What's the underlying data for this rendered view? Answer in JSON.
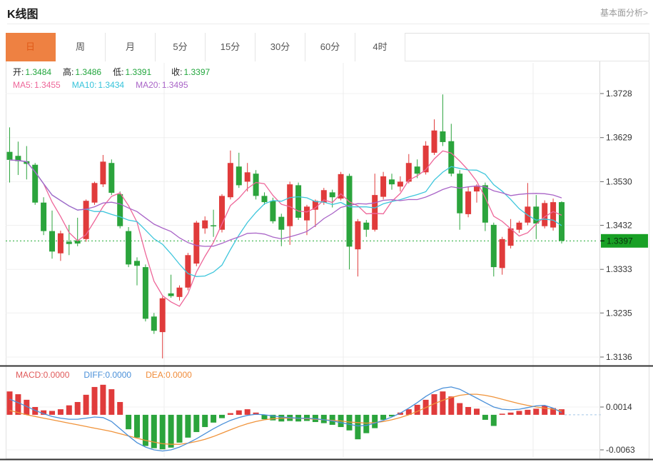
{
  "app": {
    "title": "K线图",
    "fundamental_link": "基本面分析>"
  },
  "tabs": {
    "items": [
      "日",
      "周",
      "月",
      "5分",
      "15分",
      "30分",
      "60分",
      "4时"
    ],
    "selected_index": 0
  },
  "quote": {
    "open_label": "开:",
    "open": "1.3484",
    "high_label": "高:",
    "high": "1.3486",
    "low_label": "低:",
    "low": "1.3391",
    "close_label": "收:",
    "close": "1.3397"
  },
  "ma_legend": {
    "ma5_label": "MA5:",
    "ma5": "1.3455",
    "ma10_label": "MA10:",
    "ma10": "1.3434",
    "ma20_label": "MA20:",
    "ma20": "1.3495"
  },
  "macd_legend": {
    "macd_label": "MACD:",
    "macd": "0.0000",
    "diff_label": "DIFF:",
    "diff": "0.0000",
    "dea_label": "DEA:",
    "dea": "0.0000"
  },
  "colors": {
    "up": "#e03b3b",
    "down": "#2ba43c",
    "ma5": "#ee6699",
    "ma10": "#3ec6dc",
    "ma20": "#a964c7",
    "diff_line": "#4a90d9",
    "dea_line": "#f0933a",
    "badge_bg": "#18a025",
    "badge_text": "#072c0a",
    "accent_tab": "#ee8142",
    "grid": "#f0f0f0",
    "axis": "#d8d8d8",
    "tick": "#666666",
    "dark_divider": "#333333",
    "label": "#333333",
    "last_price_line": "#22aa33",
    "zero_dash": "#a5c6e8"
  },
  "chart_data": {
    "type": "candlestick-with-macd",
    "title": "K线图",
    "legend_position": "top-left",
    "grid": true,
    "main": {
      "y_axis_labels": [
        "1.3728",
        "1.3629",
        "1.3530",
        "1.3432",
        "1.3333",
        "1.3235",
        "1.3136"
      ],
      "y_axis_values": [
        1.3728,
        1.3629,
        1.353,
        1.3432,
        1.3333,
        1.3235,
        1.3136
      ],
      "ylim": [
        1.3136,
        1.3728
      ],
      "last_price_label": "1.3397",
      "last_price": 1.3397,
      "ma_periods": [
        5,
        10,
        20
      ],
      "candles_ohlc": [
        [
          1.3597,
          1.3652,
          1.3528,
          1.3579
        ],
        [
          1.3588,
          1.362,
          1.3545,
          1.3576
        ],
        [
          1.3576,
          1.361,
          1.3535,
          1.357
        ],
        [
          1.3568,
          1.3572,
          1.3478,
          1.3483
        ],
        [
          1.3483,
          1.3495,
          1.341,
          1.3419
        ],
        [
          1.3419,
          1.3465,
          1.3357,
          1.3373
        ],
        [
          1.3369,
          1.342,
          1.3352,
          1.3414
        ],
        [
          1.3395,
          1.3433,
          1.3365,
          1.339
        ],
        [
          1.3398,
          1.3449,
          1.3385,
          1.3391
        ],
        [
          1.3401,
          1.349,
          1.3395,
          1.3487
        ],
        [
          1.3483,
          1.353,
          1.3478,
          1.3527
        ],
        [
          1.3524,
          1.359,
          1.3518,
          1.3575
        ],
        [
          1.3572,
          1.358,
          1.35,
          1.3505
        ],
        [
          1.3502,
          1.3508,
          1.3425,
          1.343
        ],
        [
          1.3419,
          1.3428,
          1.3338,
          1.3344
        ],
        [
          1.3352,
          1.336,
          1.3297,
          1.3341
        ],
        [
          1.3338,
          1.3344,
          1.3216,
          1.3222
        ],
        [
          1.3227,
          1.3235,
          1.3188,
          1.3195
        ],
        [
          1.3192,
          1.3272,
          1.3133,
          1.3268
        ],
        [
          1.3279,
          1.3321,
          1.3269,
          1.3273
        ],
        [
          1.3271,
          1.3297,
          1.3263,
          1.3292
        ],
        [
          1.3292,
          1.337,
          1.3286,
          1.3365
        ],
        [
          1.3346,
          1.3442,
          1.334,
          1.3438
        ],
        [
          1.3425,
          1.3452,
          1.3413,
          1.3443
        ],
        [
          1.3432,
          1.3467,
          1.3406,
          1.343
        ],
        [
          1.3422,
          1.3502,
          1.3416,
          1.3498
        ],
        [
          1.3495,
          1.36,
          1.349,
          1.3572
        ],
        [
          1.3564,
          1.3595,
          1.3516,
          1.3522
        ],
        [
          1.353,
          1.3572,
          1.3508,
          1.3551
        ],
        [
          1.3548,
          1.3556,
          1.349,
          1.3498
        ],
        [
          1.3498,
          1.3506,
          1.3478,
          1.3484
        ],
        [
          1.3487,
          1.3494,
          1.3436,
          1.3441
        ],
        [
          1.3451,
          1.3458,
          1.3385,
          1.3422
        ],
        [
          1.343,
          1.353,
          1.3388,
          1.3524
        ],
        [
          1.3522,
          1.3528,
          1.3444,
          1.3449
        ],
        [
          1.3443,
          1.3478,
          1.341,
          1.3474
        ],
        [
          1.3467,
          1.349,
          1.3428,
          1.3487
        ],
        [
          1.3483,
          1.3516,
          1.3478,
          1.3511
        ],
        [
          1.3506,
          1.3512,
          1.3472,
          1.3495
        ],
        [
          1.3492,
          1.3552,
          1.3488,
          1.3547
        ],
        [
          1.3543,
          1.3548,
          1.3333,
          1.3384
        ],
        [
          1.3378,
          1.3446,
          1.3317,
          1.3441
        ],
        [
          1.3438,
          1.3444,
          1.3406,
          1.3422
        ],
        [
          1.3422,
          1.3548,
          1.3418,
          1.35
        ],
        [
          1.3496,
          1.3552,
          1.349,
          1.3542
        ],
        [
          1.3535,
          1.3548,
          1.3512,
          1.3524
        ],
        [
          1.3519,
          1.3542,
          1.3508,
          1.353
        ],
        [
          1.353,
          1.3592,
          1.3526,
          1.3572
        ],
        [
          1.3564,
          1.358,
          1.3538,
          1.3548
        ],
        [
          1.3551,
          1.3621,
          1.3546,
          1.3611
        ],
        [
          1.3595,
          1.367,
          1.359,
          1.3645
        ],
        [
          1.3643,
          1.3726,
          1.361,
          1.3619
        ],
        [
          1.3621,
          1.366,
          1.3542,
          1.3548
        ],
        [
          1.3548,
          1.3556,
          1.3422,
          1.3459
        ],
        [
          1.3457,
          1.3519,
          1.345,
          1.3508
        ],
        [
          1.3508,
          1.3524,
          1.3483,
          1.3519
        ],
        [
          1.3522,
          1.3528,
          1.3419,
          1.3438
        ],
        [
          1.3433,
          1.3438,
          1.3317,
          1.3338
        ],
        [
          1.3336,
          1.3406,
          1.3321,
          1.3401
        ],
        [
          1.3386,
          1.3446,
          1.338,
          1.3425
        ],
        [
          1.3422,
          1.3442,
          1.3415,
          1.3438
        ],
        [
          1.3438,
          1.3527,
          1.3432,
          1.3474
        ],
        [
          1.3474,
          1.35,
          1.3401,
          1.3436
        ],
        [
          1.343,
          1.3488,
          1.3425,
          1.3482
        ],
        [
          1.3427,
          1.3492,
          1.342,
          1.3484
        ],
        [
          1.3484,
          1.3486,
          1.3391,
          1.3397
        ]
      ]
    },
    "macd": {
      "y_axis_labels": [
        "0.0014",
        "-0.0063"
      ],
      "y_axis_values": [
        0.0014,
        -0.0063
      ],
      "hist": [
        0.0042,
        0.0037,
        0.0027,
        0.0014,
        0.0008,
        0.0007,
        0.001,
        0.0017,
        0.0023,
        0.0036,
        0.005,
        0.0054,
        0.0046,
        0.0023,
        -0.0026,
        -0.0041,
        -0.0056,
        -0.006,
        -0.0062,
        -0.0059,
        -0.005,
        -0.0041,
        -0.0031,
        -0.0022,
        -0.0014,
        -0.0006,
        0.0003,
        0.0008,
        0.001,
        0.0004,
        -0.0008,
        -0.001,
        -0.0012,
        -0.0011,
        -0.0012,
        -0.0011,
        -0.0013,
        -0.0015,
        -0.0018,
        -0.0022,
        -0.0028,
        -0.0044,
        -0.0033,
        -0.0024,
        -0.0009,
        -0.0003,
        0.0004,
        0.001,
        0.0018,
        0.0027,
        0.0037,
        0.0042,
        0.0033,
        0.0021,
        0.0014,
        0.0011,
        -0.0009,
        -0.002,
        0.0002,
        0.0004,
        0.0007,
        0.0009,
        0.0011,
        0.0016,
        0.0012,
        0.001
      ],
      "diff": [
        0.0028,
        0.0022,
        0.0015,
        0.0008,
        0.0002,
        -0.0003,
        -0.0006,
        -0.0008,
        -0.0008,
        -0.0006,
        -0.0004,
        -0.0005,
        -0.0012,
        -0.0025,
        -0.0038,
        -0.005,
        -0.0058,
        -0.0063,
        -0.0065,
        -0.0063,
        -0.0058,
        -0.0051,
        -0.0043,
        -0.0034,
        -0.0025,
        -0.0017,
        -0.001,
        -0.0005,
        -0.0001,
        0.0001,
        0.0,
        -0.0002,
        -0.0004,
        -0.0005,
        -0.0006,
        -0.0006,
        -0.0007,
        -0.0009,
        -0.0011,
        -0.0014,
        -0.0017,
        -0.002,
        -0.0019,
        -0.0015,
        -0.001,
        -0.0004,
        0.0003,
        0.0012,
        0.0022,
        0.0033,
        0.0042,
        0.0048,
        0.005,
        0.0046,
        0.0038,
        0.003,
        0.0022,
        0.0014,
        0.001,
        0.0009,
        0.001,
        0.0013,
        0.0016,
        0.0017,
        0.0012,
        0.0004
      ],
      "dea": [
        0.0008,
        0.0004,
        0.0,
        -0.0003,
        -0.0006,
        -0.0009,
        -0.0012,
        -0.0015,
        -0.0018,
        -0.0021,
        -0.0024,
        -0.0027,
        -0.003,
        -0.0034,
        -0.0038,
        -0.0042,
        -0.0046,
        -0.0049,
        -0.0052,
        -0.0053,
        -0.0053,
        -0.0051,
        -0.0048,
        -0.0044,
        -0.0039,
        -0.0033,
        -0.0027,
        -0.0021,
        -0.0016,
        -0.0012,
        -0.0009,
        -0.0007,
        -0.0006,
        -0.0006,
        -0.0006,
        -0.0007,
        -0.0008,
        -0.0009,
        -0.001,
        -0.0011,
        -0.0013,
        -0.0014,
        -0.0015,
        -0.0014,
        -0.0012,
        -0.0009,
        -0.0005,
        0.0,
        0.0006,
        0.0013,
        0.002,
        0.0026,
        0.0031,
        0.0035,
        0.0037,
        0.0037,
        0.0035,
        0.0032,
        0.0028,
        0.0024,
        0.002,
        0.0017,
        0.0014,
        0.0012,
        0.001,
        0.0007
      ]
    }
  }
}
